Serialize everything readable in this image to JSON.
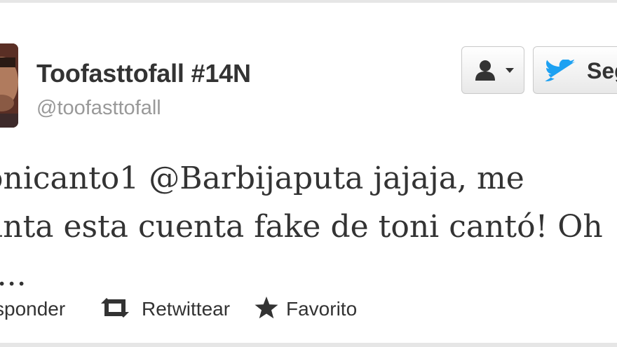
{
  "author": {
    "display_name": "Toofasttofall #14N",
    "username": "@toofasttofall"
  },
  "buttons": {
    "user_actions_icon": "person-icon",
    "follow_label": "Seg"
  },
  "tweet": {
    "lines": [
      "onicanto1 @Barbijaputa jajaja, me",
      "anta esta cuenta fake de toni cantó! Oh",
      "t..."
    ]
  },
  "actions": {
    "reply_label": "sponder",
    "retweet_label": "Retwittear",
    "favorite_label": "Favorito"
  },
  "colors": {
    "twitter_blue": "#1da1f2",
    "text": "#333333",
    "muted": "#999999"
  }
}
